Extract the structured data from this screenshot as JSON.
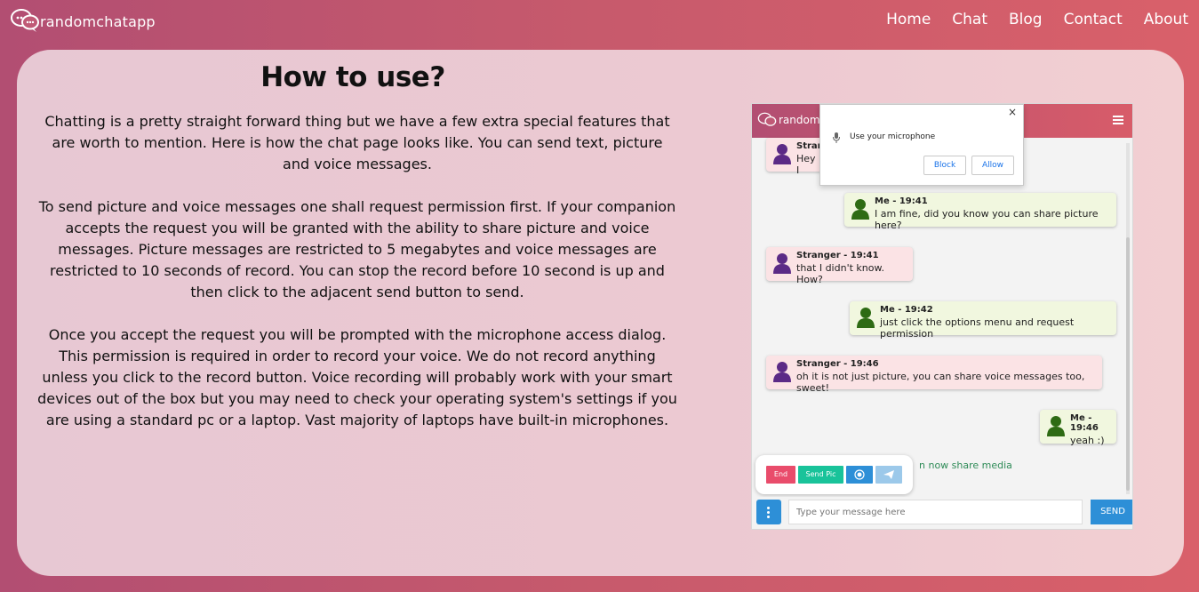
{
  "brand": {
    "name": "randomchatapp"
  },
  "nav": {
    "items": [
      "Home",
      "Chat",
      "Blog",
      "Contact",
      "About"
    ]
  },
  "article": {
    "title": "How to use?",
    "paragraphs": [
      "Chatting is a pretty straight forward thing but we have a few extra special features that are worth to mention. Here is how the chat page looks like. You can send text, picture and voice messages.",
      "To send picture and voice messages one shall request permission first. If your companion accepts the request you will be granted with the ability to share picture and voice messages. Picture messages are restricted to 5 megabytes and voice messages are restricted to 10 seconds of record. You can stop the record before 10 second is up and then click to the adjacent send button to send.",
      "Once you accept the request you will be prompted with the microphone access dialog. This permission is required in order to record your voice. We do not record anything unless you click to the record button. Voice recording will probably work with your smart devices out of the box but you may need to check your operating system's settings if you are using a standard pc or a laptop. Vast majority of laptops have built-in microphones."
    ]
  },
  "screenshot": {
    "brand": "randomc",
    "permission": {
      "text": "Use your microphone",
      "block": "Block",
      "allow": "Allow",
      "close": "×"
    },
    "messages": [
      {
        "who": "Stran",
        "text": "Hey I"
      },
      {
        "who": "Me - 19:41",
        "text": "I am fine, did you know you can share picture here?"
      },
      {
        "who": "Stranger - 19:41",
        "text": "that I didn't know. How?"
      },
      {
        "who": "Me - 19:42",
        "text": "just click the options menu and request permission"
      },
      {
        "who": "Stranger - 19:46",
        "text": "oh it is not just picture, you can share voice messages too, sweet!"
      },
      {
        "who": "Me - 19:46",
        "text": "yeah :)"
      }
    ],
    "media_note": "n now share media",
    "options": {
      "end": "End",
      "send_pic": "Send Pic"
    },
    "composer": {
      "placeholder": "Type your message here",
      "send": "SEND"
    },
    "colors": {
      "stranger_avatar": "#5b2a86",
      "me_avatar": "#2e6b14",
      "end": "#e94c6b",
      "send_pic": "#19c39a",
      "record": "#2d8fd7",
      "telegram": "#9cc9ea"
    }
  }
}
